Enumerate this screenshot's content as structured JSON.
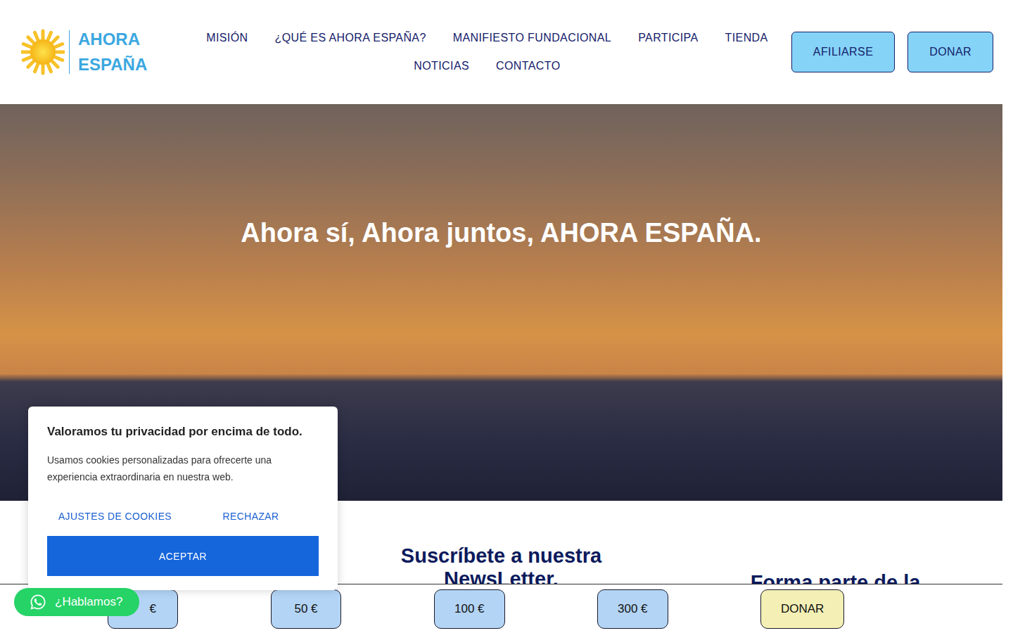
{
  "logo": {
    "line1": "AHORA",
    "line2": "ESPAÑA"
  },
  "nav_rows": [
    [
      "MISIÓN",
      "¿QUÉ ES AHORA ESPAÑA?",
      "MANIFIESTO FUNDACIONAL",
      "PARTICIPA",
      "TIENDA"
    ],
    [
      "NOTICIAS",
      "CONTACTO"
    ]
  ],
  "header_buttons": [
    "AFILIARSE",
    "DONAR"
  ],
  "hero": {
    "title": "Ahora sí, Ahora juntos, AHORA ESPAÑA."
  },
  "newsletter": {
    "title": "Suscríbete a nuestra NewsLetter."
  },
  "join": {
    "title": "Forma parte de la"
  },
  "donation_bar": {
    "amounts": [
      "€",
      "50 €",
      "100 €",
      "300 €"
    ],
    "donate": "DONAR"
  },
  "cookie_banner": {
    "title": "Valoramos tu privacidad por encima de todo.",
    "text": "Usamos cookies personalizadas para ofrecerte una experiencia extraordinaria en nuestra web.",
    "settings": "AJUSTES DE COOKIES",
    "reject": "RECHAZAR",
    "accept": "ACEPTAR"
  },
  "whatsapp": {
    "label": "¿Hablamos?"
  }
}
